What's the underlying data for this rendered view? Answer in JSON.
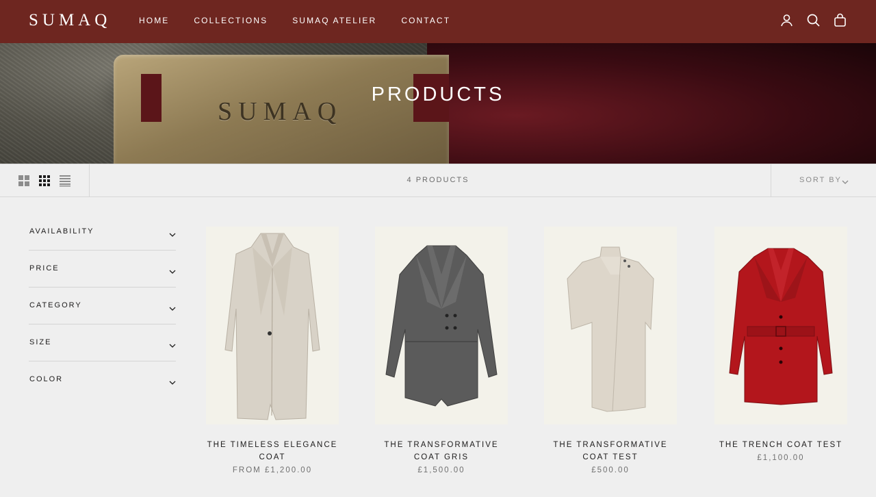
{
  "header": {
    "logo": "SUMAQ",
    "nav": [
      "HOME",
      "COLLECTIONS",
      "SUMAQ ATELIER",
      "CONTACT"
    ],
    "icons": [
      "account-icon",
      "search-icon",
      "bag-icon"
    ],
    "background_color": "#6e2620"
  },
  "hero": {
    "title": "PRODUCTS",
    "tag_text": "SUMAQ"
  },
  "toolbar": {
    "view_icons": [
      "grid-2-icon",
      "grid-4-icon",
      "list-icon"
    ],
    "product_count": "4 PRODUCTS",
    "sort_label": "SORT BY"
  },
  "filters": [
    "AVAILABILITY",
    "PRICE",
    "CATEGORY",
    "SIZE",
    "COLOR"
  ],
  "products": [
    {
      "title_line1": "THE TIMELESS ELEGANCE",
      "title_line2": "COAT",
      "price": "FROM £1,200.00",
      "coat_color": "#d8d2c7"
    },
    {
      "title_line1": "THE TRANSFORMATIVE",
      "title_line2": "COAT GRIS",
      "price": "£1,500.00",
      "coat_color": "#5b5b5b"
    },
    {
      "title_line1": "THE TRANSFORMATIVE",
      "title_line2": "COAT TEST",
      "price": "£500.00",
      "coat_color": "#ddd6ca"
    },
    {
      "title_line1": "THE TRENCH COAT TEST",
      "title_line2": "",
      "price": "£1,100.00",
      "coat_color": "#b3161c"
    }
  ]
}
